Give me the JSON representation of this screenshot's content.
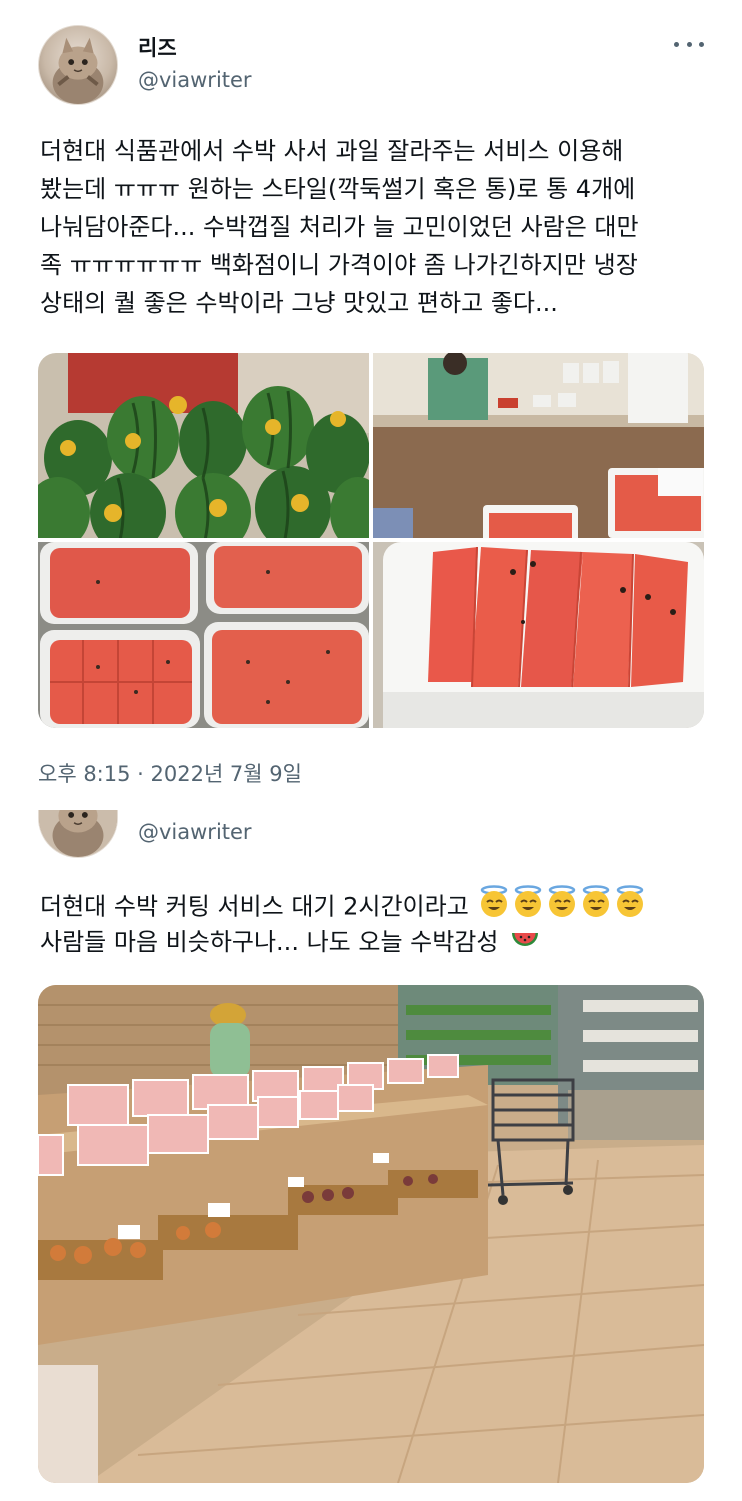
{
  "tweet1": {
    "display_name": "리즈",
    "handle": "@viawriter",
    "text": "더현대 식품관에서 수박 사서 과일 잘라주는 서비스 이용해\n봤는데 ㅠㅠㅠ 원하는 스타일(깍둑썰기 혹은 통)로 통 4개에\n나눠담아준다... 수박껍질 처리가 늘 고민이었던 사람은 대만\n족 ㅠㅠㅠㅠㅠㅠ 백화점이니 가격이야 좀 나가긴하지만 냉장\n상태의 퀄 좋은 수박이라 그냥 맛있고 편하고 좋다...",
    "timestamp": "오후 8:15 · 2022년 7월 9일",
    "photos": [
      {
        "icon": "watermelons-display-photo"
      },
      {
        "icon": "fruit-cutting-counter-photo"
      },
      {
        "icon": "watermelon-containers-photo"
      },
      {
        "icon": "watermelon-sticks-photo"
      }
    ]
  },
  "tweet2": {
    "handle": "@viawriter",
    "text_line1": "더현대 수박 커팅 서비스 대기 2시간이라고",
    "text_line2": "사람들 마음 비슷하구나... 나도 오늘 수박감성",
    "emoji_icons": [
      "smiling-halo-face-icon",
      "watermelon-icon"
    ],
    "photo": {
      "icon": "grocery-store-photo"
    }
  },
  "colors": {
    "text_primary": "#0f1419",
    "text_secondary": "#536471",
    "watermelon_red": "#e9584a",
    "rind_green": "#2f6a2c"
  }
}
